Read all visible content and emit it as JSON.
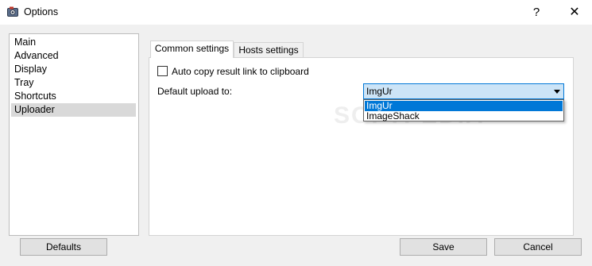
{
  "window": {
    "title": "Options",
    "help_label": "?",
    "close_label": "✕",
    "app_icon": "camera-app-icon"
  },
  "categories": {
    "items": [
      {
        "label": "Main"
      },
      {
        "label": "Advanced"
      },
      {
        "label": "Display"
      },
      {
        "label": "Tray"
      },
      {
        "label": "Shortcuts"
      },
      {
        "label": "Uploader"
      }
    ],
    "selected": "Uploader"
  },
  "tabs": [
    {
      "label": "Common settings"
    },
    {
      "label": "Hosts settings"
    }
  ],
  "settings": {
    "auto_copy_label": "Auto copy result link to clipboard",
    "auto_copy_checked": false,
    "default_upload_label": "Default upload to:",
    "default_upload_value": "ImgUr",
    "upload_options": [
      "ImgUr",
      "ImageShack"
    ]
  },
  "buttons": {
    "defaults": "Defaults",
    "save": "Save",
    "cancel": "Cancel"
  },
  "watermark": "SOFTPEDIA",
  "colors": {
    "accent": "#0078d7",
    "combo_background": "#cce4f7",
    "selected_item": "#d9d9d9"
  }
}
